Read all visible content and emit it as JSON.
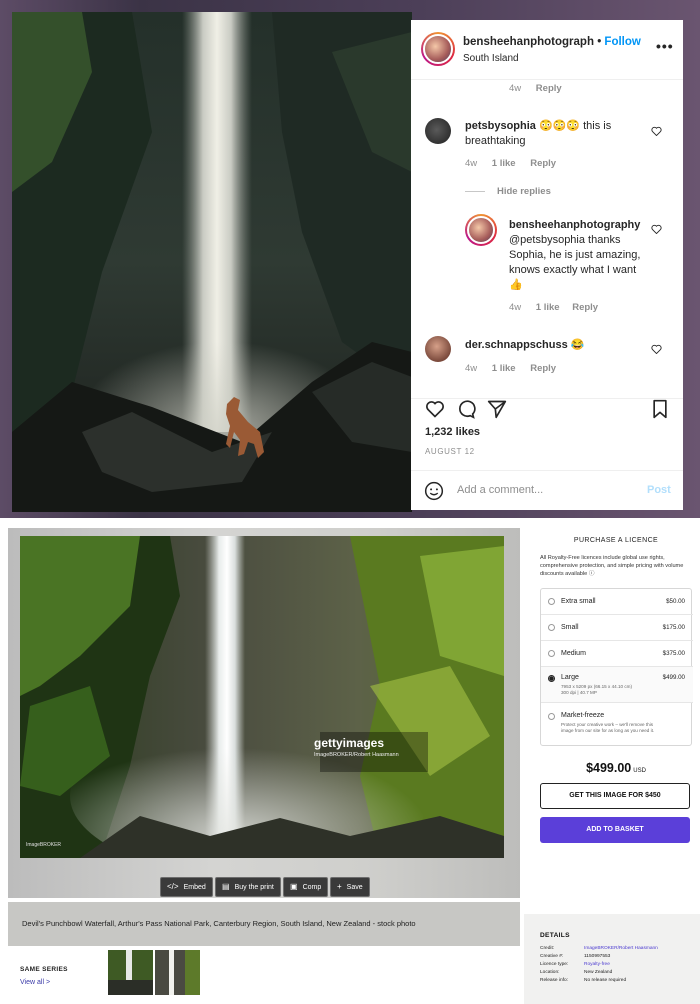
{
  "instagram": {
    "username": "bensheehanphotograph",
    "separator": "•",
    "follow_label": "Follow",
    "location": "South Island",
    "more_label": "•••",
    "top_comment_meta": {
      "age": "4w",
      "reply": "Reply"
    },
    "comments": [
      {
        "user": "petsbysophia",
        "text": "😳😳😳 this is breathtaking",
        "age": "4w",
        "likes": "1 like",
        "reply": "Reply",
        "hide_replies": "Hide replies"
      },
      {
        "user": "bensheehanphotography",
        "text": "@petsbysophia thanks Sophia, he is just amazing, knows exactly what I want 👍",
        "age": "4w",
        "likes": "1 like",
        "reply": "Reply"
      },
      {
        "user": "der.schnappschuss",
        "text": "😂",
        "age": "4w",
        "likes": "1 like",
        "reply": "Reply"
      }
    ],
    "likes": "1,232 likes",
    "date": "AUGUST 12",
    "add_comment_placeholder": "Add a comment...",
    "post_label": "Post"
  },
  "getty": {
    "watermark_brand": "gettyimages",
    "watermark_credit": "ImageBROKER/Robert Haasmann",
    "corner_credit": "ImageBROKER",
    "toolbar": [
      {
        "icon": "code-icon",
        "glyph": "</>",
        "label": "Embed"
      },
      {
        "icon": "print-icon",
        "glyph": "▤",
        "label": "Buy the print"
      },
      {
        "icon": "comp-icon",
        "glyph": "▣",
        "label": "Comp"
      },
      {
        "icon": "plus-icon",
        "glyph": "+",
        "label": "Save"
      }
    ],
    "caption": "Devil's Punchbowl Waterfall, Arthur's Pass National Park, Canterbury Region, South Island, New Zealand - stock photo",
    "same_series": "SAME SERIES",
    "view_all": "View all >",
    "purchase": {
      "title": "PURCHASE A LICENCE",
      "description": "All Royalty-Free licences include global use rights, comprehensive protection, and simple pricing with volume discounts available ⓘ",
      "options": [
        {
          "name": "Extra small",
          "price": "$50.00",
          "selected": false
        },
        {
          "name": "Small",
          "price": "$175.00",
          "selected": false
        },
        {
          "name": "Medium",
          "price": "$375.00",
          "selected": false
        },
        {
          "name": "Large",
          "price": "$499.00",
          "selected": true,
          "detail1": "7953 x 5209 px (66.15 x 44.10 cm)",
          "detail2": "300 dpi | 40.7 MP"
        },
        {
          "name": "Market-freeze",
          "price": "",
          "selected": false,
          "detail1": "Protect your creative work – we'll remove this",
          "detail2": "image from our site for as long as you need it."
        }
      ],
      "total": "$499.00",
      "currency": "USD",
      "get_button": "GET THIS IMAGE FOR $450",
      "add_button": "ADD TO BASKET"
    },
    "details": {
      "title": "DETAILS",
      "rows": [
        {
          "label": "Credit:",
          "value": "ImageBROKER/Robert Haasmann",
          "link": true
        },
        {
          "label": "Creative #:",
          "value": "1150997553",
          "link": false
        },
        {
          "label": "Licence type:",
          "value": "Royalty-free",
          "link": true
        },
        {
          "label": "Location:",
          "value": "New Zealand",
          "link": false
        },
        {
          "label": "Release info:",
          "value": "No release required",
          "link": false
        }
      ]
    }
  }
}
